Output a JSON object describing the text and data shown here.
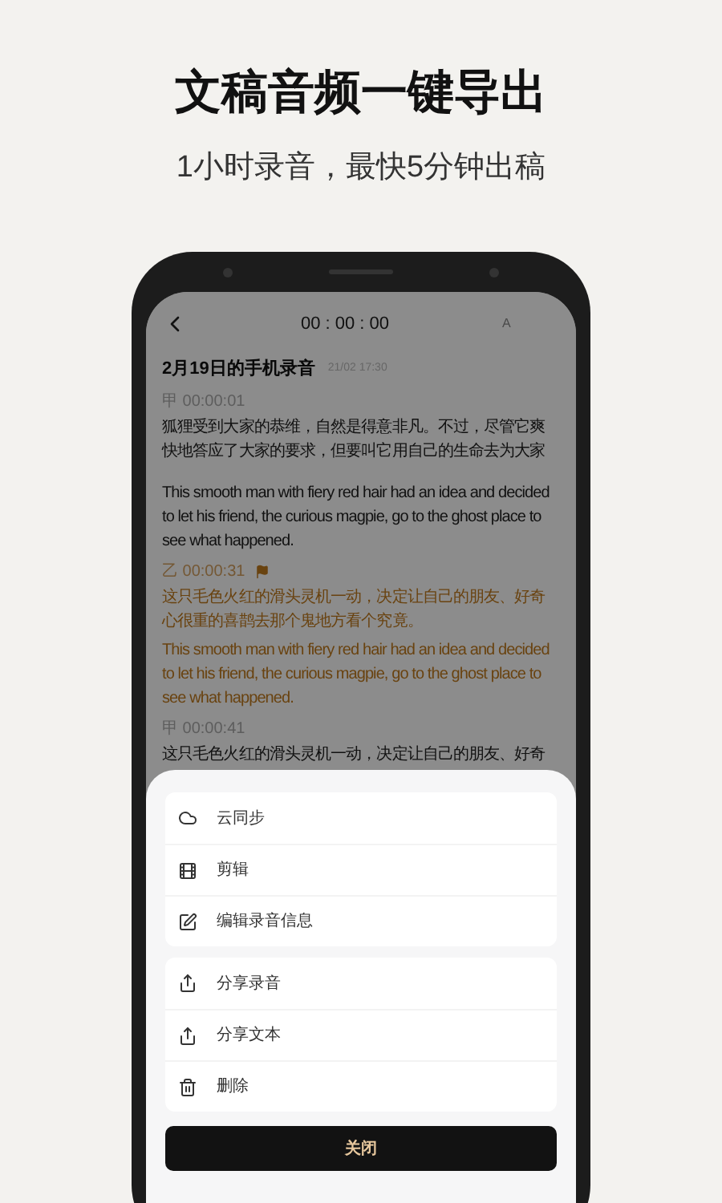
{
  "heading": "文稿音频一键导出",
  "subheading": "1小时录音，最快5分钟出稿",
  "recording": {
    "timer": "00 : 00 : 00",
    "font_button": "A",
    "title": "2月19日的手机录音",
    "date": "21/02 17:30",
    "segments": [
      {
        "speaker": "甲",
        "time": "00:00:01",
        "highlighted": false,
        "flagged": false,
        "paragraphs": [
          "狐狸受到大家的恭维，自然是得意非凡。不过，尽管它爽快地答应了大家的要求，但要叫它用自己的生命去为大家",
          "This smooth man with fiery red hair had an idea and decided to let his friend, the curious magpie, go to the ghost place to see what happened."
        ]
      },
      {
        "speaker": "乙",
        "time": "00:00:31",
        "highlighted": true,
        "flagged": true,
        "paragraphs": [
          "这只毛色火红的滑头灵机一动，决定让自己的朋友、好奇心很重的喜鹊去那个鬼地方看个究竟。",
          "This smooth man with fiery red hair had an idea and decided to let his friend, the curious magpie, go to the ghost place to see what happened."
        ]
      },
      {
        "speaker": "甲",
        "time": "00:00:41",
        "highlighted": false,
        "flagged": false,
        "paragraphs": [
          "这只毛色火红的滑头灵机一动，决定让自己的朋友、好奇"
        ]
      }
    ]
  },
  "menu": {
    "groups": [
      [
        {
          "kind": "cloud",
          "label": "云同步"
        },
        {
          "kind": "cut",
          "label": "剪辑"
        },
        {
          "kind": "edit",
          "label": "编辑录音信息"
        }
      ],
      [
        {
          "kind": "share",
          "label": "分享录音"
        },
        {
          "kind": "share",
          "label": "分享文本"
        },
        {
          "kind": "trash",
          "label": "删除"
        }
      ]
    ],
    "close": "关闭"
  }
}
